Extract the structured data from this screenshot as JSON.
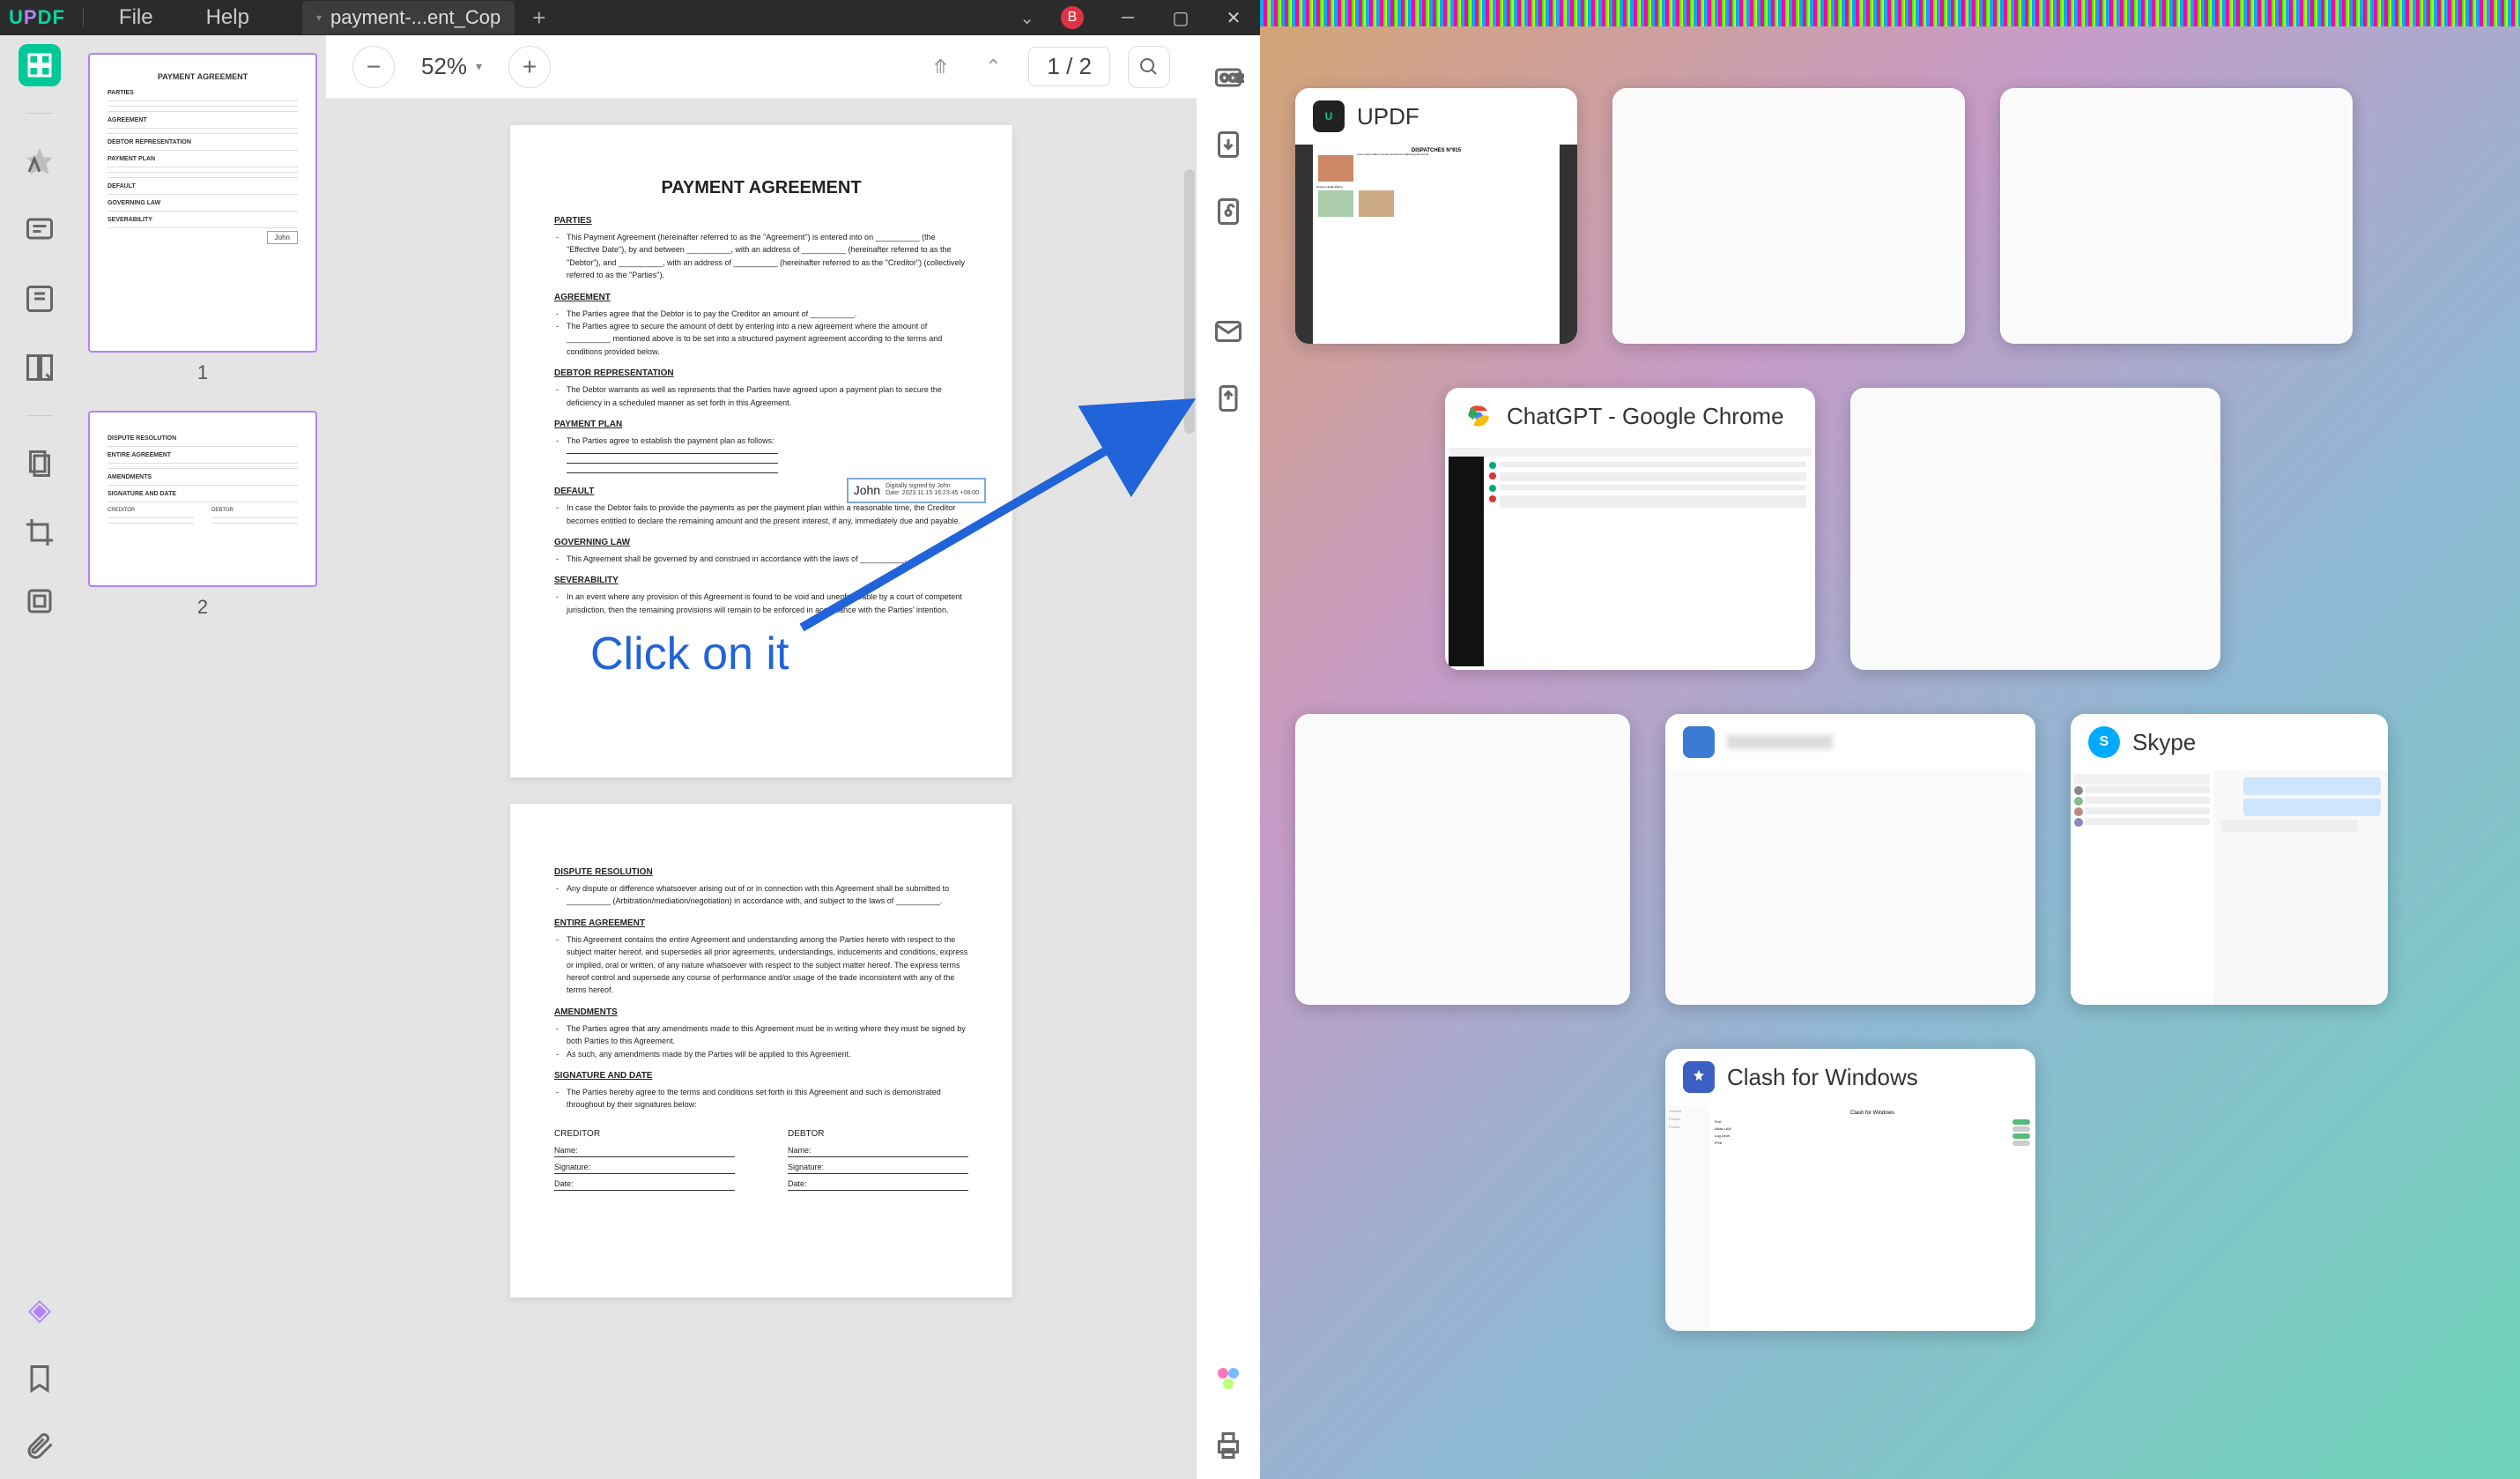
{
  "app": {
    "logo": "UPDF",
    "menus": [
      "File",
      "Help"
    ],
    "tab_filename": "payment-...ent_Cop",
    "user_initial": "B"
  },
  "toolbar": {
    "zoom": "52%",
    "page_current": "1",
    "page_sep": "/",
    "page_total": "2"
  },
  "thumbnails": {
    "pages": [
      "1",
      "2"
    ]
  },
  "document": {
    "title": "PAYMENT AGREEMENT",
    "sections": {
      "parties": "PARTIES",
      "parties_body1": "This Payment Agreement (hereinafter referred to as the \"Agreement\") is entered into on __________ (the \"Effective Date\"), by and between __________, with an address of __________ (hereinafter referred to as the \"Debtor\"), and __________, with an address of __________ (hereinafter referred to as the \"Creditor\") (collectively referred to as the \"Parties\").",
      "agreement": "AGREEMENT",
      "agreement_body1": "The Parties agree that the Debtor is to pay the Creditor an amount of __________.",
      "agreement_body2": "The Parties agree to secure the amount of debt by entering into a new agreement where the amount of __________ mentioned above is to be set into a structured payment agreement according to the terms and conditions provided below.",
      "debtor_rep": "DEBTOR REPRESENTATION",
      "debtor_rep_body": "The Debtor warrants as well as represents that the Parties have agreed upon a payment plan to secure the deficiency in a scheduled manner as set forth in this Agreement.",
      "payment_plan": "PAYMENT PLAN",
      "payment_plan_body": "The Parties agree to establish the payment plan as follows:",
      "default": "DEFAULT",
      "default_body": "In case the Debtor fails to provide the payments as per the payment plan within a reasonable time, the Creditor becomes entitled to declare the remaining amount and the present interest, if any, immediately due and payable.",
      "governing": "GOVERNING LAW",
      "governing_body": "This Agreement shall be governed by and construed in accordance with the laws of __________.",
      "severability": "SEVERABILITY",
      "severability_body": "In an event where any provision of this Agreement is found to be void and unenforceable by a court of competent jurisdiction, then the remaining provisions will remain to be enforced in accordance with the Parties' intention.",
      "dispute": "DISPUTE RESOLUTION",
      "dispute_body": "Any dispute or difference whatsoever arising out of or in connection with this Agreement shall be submitted to __________ (Arbitration/mediation/negotiation) in accordance with, and subject to the laws of __________.",
      "entire": "ENTIRE AGREEMENT",
      "entire_body": "This Agreement contains the entire Agreement and understanding among the Parties hereto with respect to the subject matter hereof, and supersedes all prior agreements, understandings, inducements and conditions, express or implied, oral or written, of any nature whatsoever with respect to the subject matter hereof. The express terms hereof control and supersede any course of performance and/or usage of the trade inconsistent with any of the terms hereof.",
      "amendments": "AMENDMENTS",
      "amendments_body1": "The Parties agree that any amendments made to this Agreement must be in writing where they must be signed by both Parties to this Agreement.",
      "amendments_body2": "As such, any amendments made by the Parties will be applied to this Agreement.",
      "sigdate": "SIGNATURE AND DATE",
      "sigdate_body": "The Parties hereby agree to the terms and conditions set forth in this Agreement and such is demonstrated throughout by their signatures below:",
      "creditor": "CREDITOR",
      "debtor": "DEBTOR",
      "name_label": "Name:",
      "signature_label": "Signature:",
      "date_label": "Date:"
    },
    "signature": {
      "name": "John",
      "meta_signed": "Digitally signed by John",
      "meta_date": "Date: 2023.11.15 16:23:45 +08:00"
    },
    "thumb_sig": "John"
  },
  "annotation": {
    "text": "Click on it"
  },
  "task_switcher": {
    "cards": {
      "updf": "UPDF",
      "chatgpt": "ChatGPT - Google Chrome",
      "skype": "Skype",
      "clash": "Clash for Windows"
    },
    "updf_preview_title": "DISPATCHES N°915"
  }
}
